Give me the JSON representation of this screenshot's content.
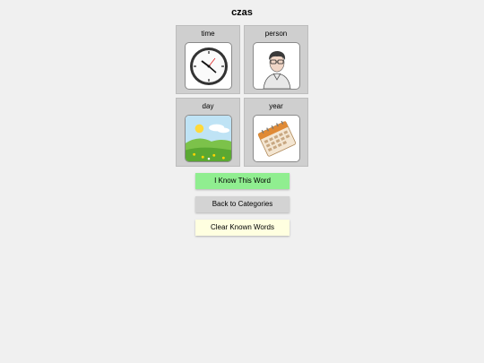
{
  "page": {
    "title": "czas"
  },
  "cards": [
    {
      "label": "time",
      "icon": "clock-icon"
    },
    {
      "label": "person",
      "icon": "person-icon"
    },
    {
      "label": "day",
      "icon": "meadow-icon"
    },
    {
      "label": "year",
      "icon": "calendar-icon"
    }
  ],
  "buttons": {
    "know": "I Know This Word",
    "back": "Back to Categories",
    "clear": "Clear Known Words"
  },
  "colors": {
    "know_button": "#90ee90",
    "back_button": "#d3d3d3",
    "clear_button": "#ffffe0",
    "card_bg": "#cfcfcf",
    "page_bg": "#f0f0f0"
  }
}
